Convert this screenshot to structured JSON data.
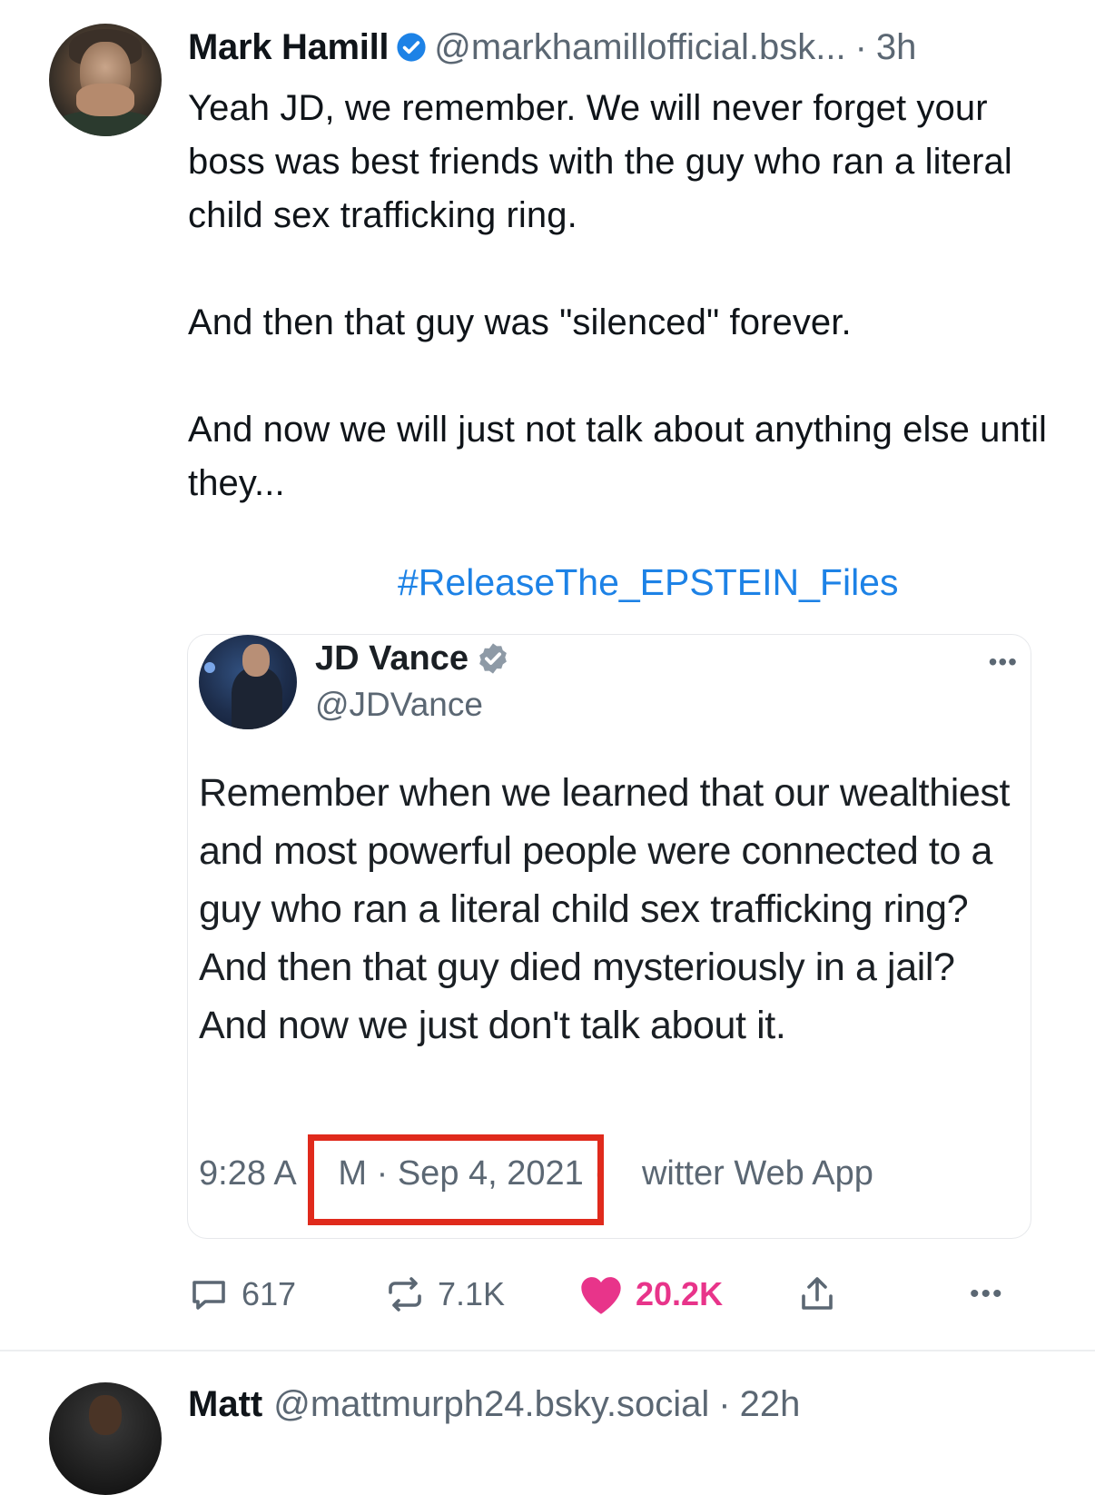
{
  "post": {
    "author": "Mark Hamill",
    "handle": "@markhamillofficial.bsk...",
    "separator": "·",
    "time": "3h",
    "text": "Yeah JD, we remember. We will never forget your boss was best friends with the guy who ran a literal child sex trafficking ring.\n\nAnd then that guy was \"silenced\" forever.\n\nAnd now we will just not talk about anything else until they...",
    "hashtag": "#ReleaseThe_EPSTEIN_Files",
    "verified_color": "#1d82e6"
  },
  "quoted": {
    "author": "JD Vance",
    "handle": "@JDVance",
    "more": "•••",
    "text": "Remember when we learned that our wealthiest and most powerful people were connected to a guy who ran a literal child sex trafficking ring? And then that guy died mysteriously in a jail? And now we just don't talk about it.",
    "meta": "9:28 A      M · Sep 4, 2021 ·     witter Web App",
    "highlight_color": "#e02a1c"
  },
  "actions": {
    "replies": "617",
    "reposts": "7.1K",
    "likes": "20.2K",
    "more": "•••",
    "like_color": "#e8348a",
    "icons": [
      "reply-icon",
      "repost-icon",
      "heart-icon",
      "share-icon",
      "more-icon"
    ]
  },
  "next_post": {
    "author": "Matt",
    "handle": "@mattmurph24.bsky.social",
    "separator": "·",
    "time": "22h"
  }
}
